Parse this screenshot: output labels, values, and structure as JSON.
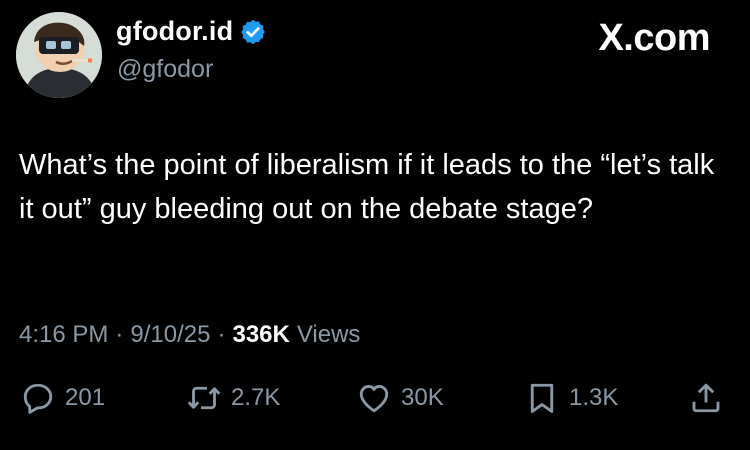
{
  "author": {
    "display_name": "gfodor.id",
    "handle": "@gfodor",
    "verified_icon": "verified-badge-icon",
    "avatar_icon": "cartoon-vr-headset-avatar"
  },
  "brand": "X.com",
  "tweet": {
    "text": "What’s the point of liberalism if it leads to the “let’s talk it out” guy bleeding out on the debate stage?"
  },
  "meta": {
    "time": "4:16 PM",
    "separator": "·",
    "date": "9/10/25",
    "views_count": "336K",
    "views_label": "Views"
  },
  "actions": {
    "replies": "201",
    "reposts": "2.7K",
    "likes": "30K",
    "bookmarks": "1.3K"
  },
  "colors": {
    "background": "#000000",
    "text": "#ffffff",
    "secondary": "#8b98a5",
    "verified": "#1d9bf0"
  }
}
